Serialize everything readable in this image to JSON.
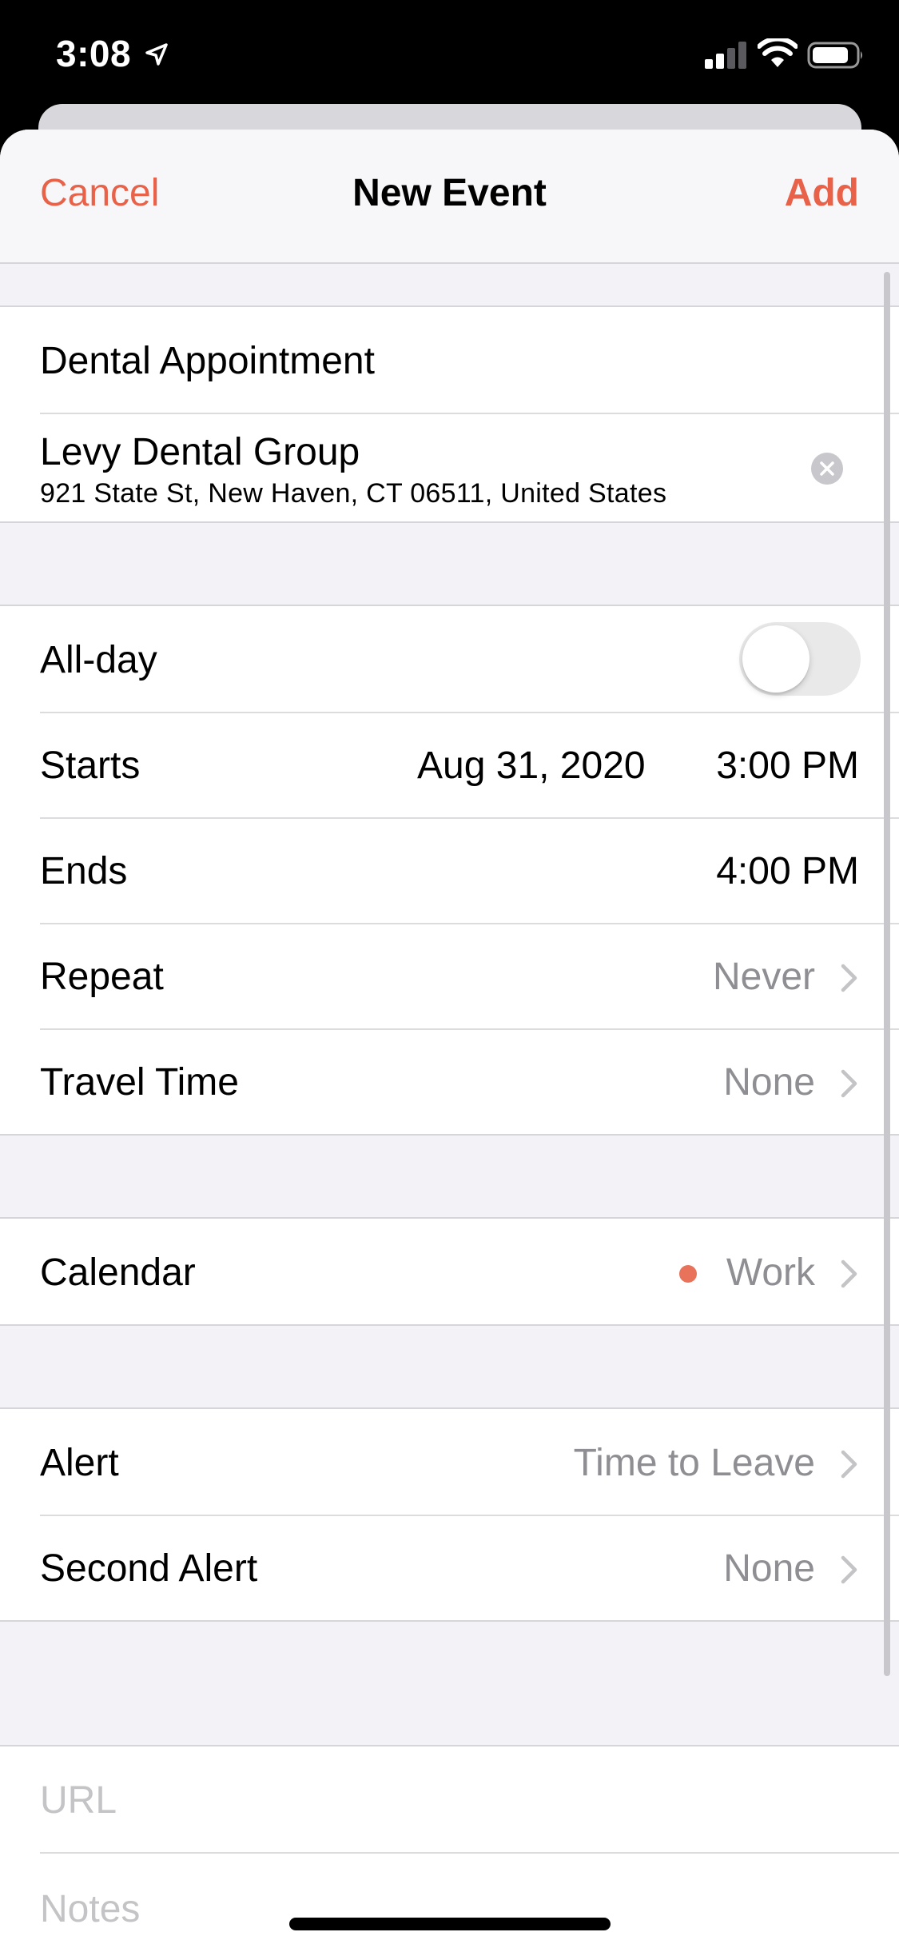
{
  "status_bar": {
    "time": "3:08",
    "icons": [
      "location-arrow-icon",
      "cellular-signal-icon",
      "wifi-icon",
      "battery-icon"
    ]
  },
  "nav": {
    "cancel_label": "Cancel",
    "title": "New Event",
    "add_label": "Add"
  },
  "event": {
    "title": "Dental Appointment",
    "location_name": "Levy Dental Group",
    "location_address": "921 State St, New Haven, CT  06511, United States"
  },
  "time_section": {
    "allday_label": "All-day",
    "allday_on": false,
    "starts_label": "Starts",
    "starts_date": "Aug 31, 2020",
    "starts_time": "3:00 PM",
    "ends_label": "Ends",
    "ends_time": "4:00 PM",
    "repeat_label": "Repeat",
    "repeat_value": "Never",
    "travel_label": "Travel Time",
    "travel_value": "None"
  },
  "calendar_section": {
    "label": "Calendar",
    "value": "Work",
    "color": "#e8735a"
  },
  "alert_section": {
    "alert_label": "Alert",
    "alert_value": "Time to Leave",
    "second_alert_label": "Second Alert",
    "second_alert_value": "None"
  },
  "notes_section": {
    "url_placeholder": "URL",
    "notes_placeholder": "Notes"
  },
  "colors": {
    "accent": "#e8624a",
    "secondary_text": "#8e8e93",
    "background": "#f2f2f7"
  }
}
